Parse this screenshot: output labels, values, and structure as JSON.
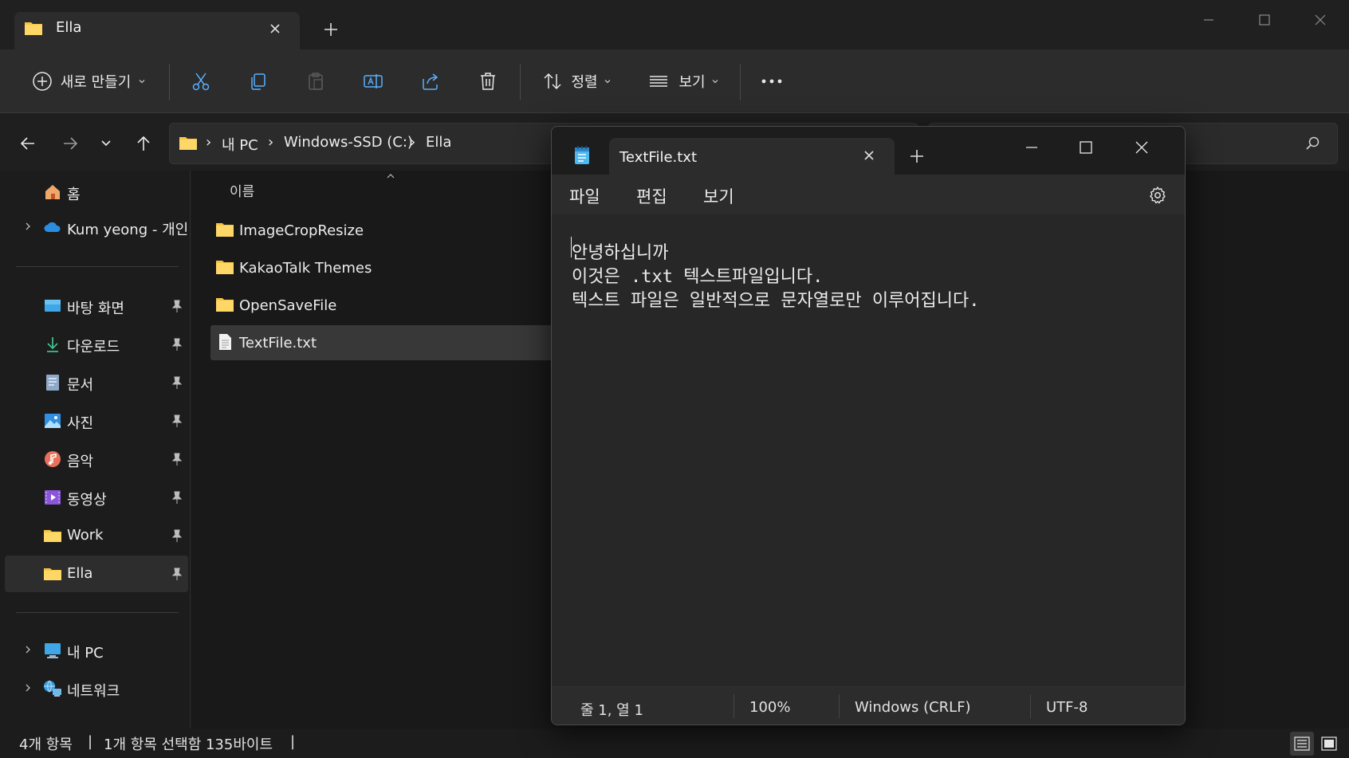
{
  "explorer": {
    "tab_title": "Ella",
    "toolbar": {
      "new_label": "새로 만들기",
      "sort_label": "정렬",
      "view_label": "보기"
    },
    "breadcrumb": {
      "items": [
        "내 PC",
        "Windows-SSD (C:)",
        "Ella"
      ]
    },
    "sidebar": {
      "home": "홈",
      "onedrive": "Kum yeong - 개인",
      "pinned": [
        {
          "label": "바탕 화면",
          "icon": "desktop-icon"
        },
        {
          "label": "다운로드",
          "icon": "download-icon"
        },
        {
          "label": "문서",
          "icon": "documents-icon"
        },
        {
          "label": "사진",
          "icon": "pictures-icon"
        },
        {
          "label": "음악",
          "icon": "music-icon"
        },
        {
          "label": "동영상",
          "icon": "videos-icon"
        },
        {
          "label": "Work",
          "icon": "folder-icon"
        },
        {
          "label": "Ella",
          "icon": "folder-icon"
        }
      ],
      "this_pc": "내 PC",
      "network": "네트워크"
    },
    "column_header": "이름",
    "files": [
      {
        "name": "ImageCropResize",
        "type": "folder"
      },
      {
        "name": "KakaoTalk Themes",
        "type": "folder"
      },
      {
        "name": "OpenSaveFile",
        "type": "folder"
      },
      {
        "name": "TextFile.txt",
        "type": "text"
      }
    ],
    "status": {
      "item_count": "4개 항목",
      "selection": "1개 항목 선택함 135바이트"
    }
  },
  "notepad": {
    "tab_title": "TextFile.txt",
    "menu": {
      "file": "파일",
      "edit": "편집",
      "view": "보기"
    },
    "content": {
      "line1": "안녕하십니까",
      "line2": "이것은 .txt 텍스트파일입니다.",
      "line3": "텍스트 파일은 일반적으로 문자열로만 이루어집니다."
    },
    "status": {
      "position": "줄 1, 열 1",
      "zoom": "100%",
      "line_ending": "Windows (CRLF)",
      "encoding": "UTF-8"
    }
  },
  "colors": {
    "folder": "#f4c542",
    "accent": "#4cc2ff",
    "background": "#191919"
  }
}
